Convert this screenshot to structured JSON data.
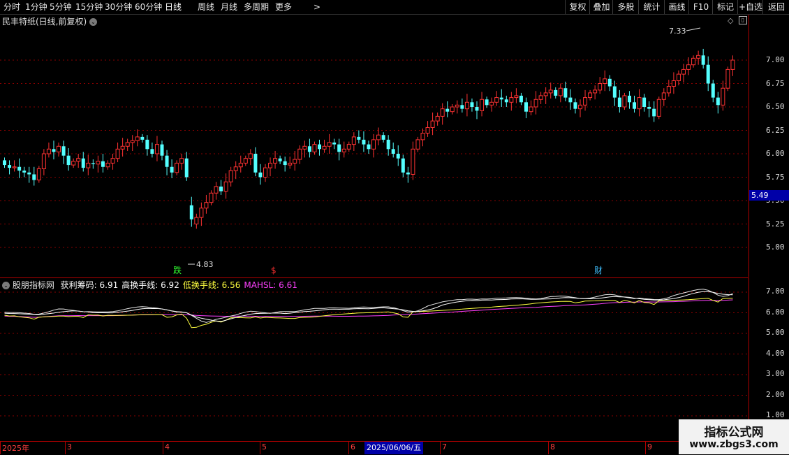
{
  "toolbar": {
    "periods": [
      "分时",
      "1分钟",
      "5分钟",
      "15分钟",
      "30分钟",
      "60分钟",
      "日线",
      "周线",
      "月线",
      "多周期",
      "更多"
    ],
    "more_arrow": ">",
    "active_period": "日线",
    "right_buttons": [
      "复权",
      "叠加",
      "多股",
      "统计",
      "画线",
      "F10",
      "标记",
      "+自选",
      "返回"
    ]
  },
  "main_chart": {
    "title": "民丰特纸(日线,前复权)",
    "current_price_tag": "5.49",
    "high_annotation": "7.33",
    "low_annotation": "4.83",
    "markers": [
      {
        "label": "跌",
        "color": "#30ff30"
      },
      {
        "label": "$",
        "color": "#ff3030"
      },
      {
        "label": "财",
        "color": "#40c0ff"
      }
    ],
    "y_ticks": [
      "7.00",
      "6.75",
      "6.50",
      "6.25",
      "6.00",
      "5.75",
      "5.50",
      "5.25",
      "5.00"
    ]
  },
  "sub_chart": {
    "title": "股朋指标网",
    "indicators": [
      {
        "name": "获利筹码",
        "value": "6.91",
        "text": "获利筹码: 6.91",
        "color": "#ffffff"
      },
      {
        "name": "高换手线",
        "value": "6.92",
        "text": "高换手线: 6.92",
        "color": "#ffffff"
      },
      {
        "name": "低换手线",
        "value": "6.56",
        "text": "低换手线: 6.56",
        "color": "#ffff40"
      },
      {
        "name": "MAHSL",
        "value": "6.61",
        "text": "MAHSL: 6.61",
        "color": "#ff40ff"
      }
    ],
    "y_ticks": [
      "7.00",
      "6.00",
      "5.00",
      "4.00",
      "3.00",
      "2.00",
      "1.00"
    ]
  },
  "time_axis": {
    "labels": [
      "2025年",
      "3",
      "4",
      "5",
      "6",
      "7",
      "8",
      "9"
    ],
    "cursor_date": "2025/06/06/五"
  },
  "watermark": {
    "line1": "指标公式网",
    "line2": "www.zbgs3.com"
  },
  "colors": {
    "up": "#ff3232",
    "down": "#54ffff",
    "grid": "#8a0000",
    "axis_border": "#b00000"
  },
  "chart_data": {
    "type": "candlestick",
    "period": "daily",
    "y_range": [
      4.8,
      7.35
    ],
    "bars_open": [
      5.93,
      5.88,
      5.85,
      5.86,
      5.82,
      5.8,
      5.78,
      5.72,
      5.84,
      6.0,
      6.05,
      6.02,
      6.08,
      5.98,
      5.88,
      5.92,
      5.95,
      5.85,
      5.9,
      5.89,
      5.92,
      5.86,
      5.9,
      5.95,
      6.05,
      6.08,
      6.12,
      6.14,
      6.18,
      6.15,
      6.05,
      6.0,
      6.1,
      5.98,
      5.86,
      5.8,
      5.9,
      5.95,
      5.45,
      5.25,
      5.32,
      5.42,
      5.48,
      5.58,
      5.65,
      5.6,
      5.7,
      5.82,
      5.86,
      5.9,
      5.95,
      6.0,
      5.8,
      5.75,
      5.85,
      5.9,
      5.95,
      5.92,
      5.88,
      5.9,
      5.94,
      6.05,
      6.08,
      6.02,
      6.1,
      6.05,
      6.08,
      6.12,
      6.1,
      6.02,
      6.05,
      6.1,
      6.18,
      6.15,
      6.1,
      6.05,
      6.15,
      6.2,
      6.15,
      6.05,
      6.0,
      5.95,
      5.8,
      5.78,
      6.05,
      6.15,
      6.22,
      6.28,
      6.35,
      6.4,
      6.48,
      6.45,
      6.5,
      6.52,
      6.48,
      6.55,
      6.5,
      6.46,
      6.58,
      6.52,
      6.55,
      6.6,
      6.58,
      6.55,
      6.6,
      6.62,
      6.55,
      6.45,
      6.5,
      6.58,
      6.62,
      6.65,
      6.68,
      6.62,
      6.7,
      6.6,
      6.55,
      6.48,
      6.52,
      6.6,
      6.65,
      6.68,
      6.75,
      6.8,
      6.72,
      6.6,
      6.5,
      6.62,
      6.55,
      6.48,
      6.6,
      6.5,
      6.48,
      6.4,
      6.58,
      6.65,
      6.72,
      6.78,
      6.85,
      6.9,
      6.95,
      7.02,
      7.05,
      6.95,
      6.75,
      6.6,
      6.52,
      6.7,
      6.9
    ],
    "bars_close": [
      5.88,
      5.85,
      5.86,
      5.82,
      5.8,
      5.78,
      5.72,
      5.84,
      6.0,
      6.05,
      6.02,
      6.08,
      5.98,
      5.88,
      5.92,
      5.95,
      5.85,
      5.9,
      5.89,
      5.92,
      5.86,
      5.9,
      5.95,
      6.05,
      6.08,
      6.12,
      6.14,
      6.18,
      6.15,
      6.05,
      6.0,
      6.1,
      5.98,
      5.86,
      5.8,
      5.9,
      5.95,
      5.75,
      5.3,
      5.32,
      5.42,
      5.48,
      5.58,
      5.65,
      5.6,
      5.7,
      5.82,
      5.86,
      5.9,
      5.95,
      6.0,
      5.8,
      5.75,
      5.85,
      5.9,
      5.95,
      5.92,
      5.88,
      5.9,
      5.94,
      6.05,
      6.08,
      6.02,
      6.1,
      6.05,
      6.08,
      6.12,
      6.1,
      6.02,
      6.05,
      6.1,
      6.18,
      6.15,
      6.1,
      6.05,
      6.15,
      6.2,
      6.15,
      6.05,
      6.0,
      5.95,
      5.8,
      5.78,
      6.05,
      6.15,
      6.22,
      6.28,
      6.35,
      6.4,
      6.48,
      6.45,
      6.5,
      6.52,
      6.48,
      6.55,
      6.5,
      6.46,
      6.58,
      6.52,
      6.55,
      6.6,
      6.58,
      6.55,
      6.6,
      6.62,
      6.55,
      6.45,
      6.5,
      6.58,
      6.62,
      6.65,
      6.68,
      6.62,
      6.7,
      6.6,
      6.55,
      6.48,
      6.52,
      6.6,
      6.65,
      6.68,
      6.75,
      6.8,
      6.72,
      6.6,
      6.5,
      6.62,
      6.55,
      6.48,
      6.6,
      6.5,
      6.48,
      6.4,
      6.58,
      6.65,
      6.72,
      6.78,
      6.85,
      6.9,
      6.95,
      7.02,
      7.05,
      6.95,
      6.75,
      6.6,
      6.52,
      6.7,
      6.9,
      7.0
    ]
  }
}
